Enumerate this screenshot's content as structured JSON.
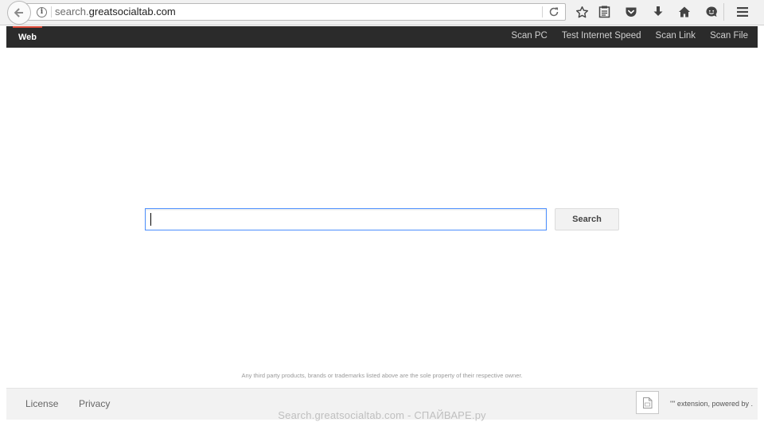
{
  "browser": {
    "url_prefix": "search.",
    "url_domain": "greatsocialtab.com"
  },
  "nav": {
    "brand_tab": "Web",
    "links": [
      "Scan PC",
      "Test Internet Speed",
      "Scan Link",
      "Scan File"
    ]
  },
  "search": {
    "input_value": "",
    "button_label": "Search"
  },
  "disclaimer": "Any third party products, brands or trademarks listed above are the sole property of their respective owner.",
  "footer": {
    "license_label": "License",
    "privacy_label": "Privacy",
    "extension_text": "\"\" extension, powered by ."
  },
  "watermark": "Search.greatsocialtab.com - СПАЙВАРЕ.ру",
  "colors": {
    "nav_background": "#2b2b2b",
    "active_tab_accent": "#dd4b39",
    "search_focus_border": "#4d90fe"
  },
  "icons": [
    "back-arrow-icon",
    "info-icon",
    "reload-icon",
    "bookmark-star-icon",
    "reading-list-icon",
    "pocket-icon",
    "download-icon",
    "home-icon",
    "hello-chat-icon",
    "hamburger-menu-icon",
    "extension-image-icon"
  ]
}
